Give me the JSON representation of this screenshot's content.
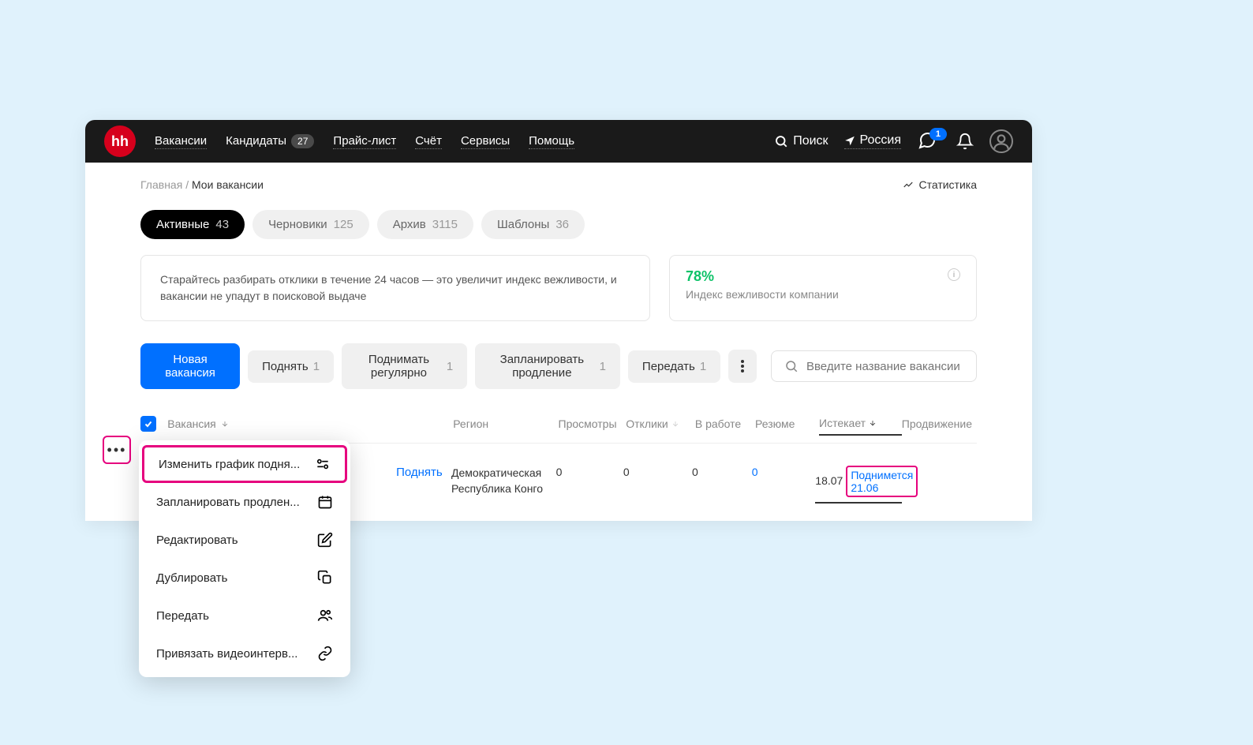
{
  "header": {
    "logo": "hh",
    "nav": {
      "vacancies": "Вакансии",
      "candidates": "Кандидаты",
      "candidates_badge": "27",
      "pricing": "Прайс-лист",
      "account": "Счёт",
      "services": "Сервисы",
      "help": "Помощь"
    },
    "search_label": "Поиск",
    "region": "Россия",
    "chat_count": "1"
  },
  "breadcrumb": {
    "home": "Главная",
    "sep": "/",
    "current": "Мои вакансии",
    "stats": "Статистика"
  },
  "tabs": {
    "active": {
      "label": "Активные",
      "count": "43"
    },
    "drafts": {
      "label": "Черновики",
      "count": "125"
    },
    "archive": {
      "label": "Архив",
      "count": "3115"
    },
    "templates": {
      "label": "Шаблоны",
      "count": "36"
    }
  },
  "info": {
    "tip": "Старайтесь разбирать отклики в течение 24 часов — это увеличит индекс вежливости, и вакансии не упадут в поисковой выдаче",
    "politeness_pct": "78%",
    "politeness_label": "Индекс вежливости компании"
  },
  "actions": {
    "new_vacancy": "Новая вакансия",
    "raise": "Поднять",
    "raise_count": "1",
    "recurring": "Поднимать регулярно",
    "recurring_count": "1",
    "schedule": "Запланировать продление",
    "schedule_count": "1",
    "transfer": "Передать",
    "transfer_count": "1",
    "search_placeholder": "Введите название вакансии"
  },
  "table": {
    "headers": {
      "vacancy": "Вакансия",
      "region": "Регион",
      "views": "Просмотры",
      "applies": "Отклики",
      "in_work": "В работе",
      "resume": "Резюме",
      "expires": "Истекает",
      "promotion": "Продвижение"
    },
    "row": {
      "raise_link": "Поднять",
      "region": "Демократическая Республика Конго",
      "views": "0",
      "applies": "0",
      "in_work": "0",
      "resume": "0",
      "expires_date": "18.07",
      "raises_text": "Поднимется 21.06"
    }
  },
  "dropdown": {
    "change_schedule": "Изменить график подня...",
    "schedule_extension": "Запланировать продлен...",
    "edit": "Редактировать",
    "duplicate": "Дублировать",
    "transfer": "Передать",
    "attach_video": "Привязать видеоинтерв..."
  }
}
